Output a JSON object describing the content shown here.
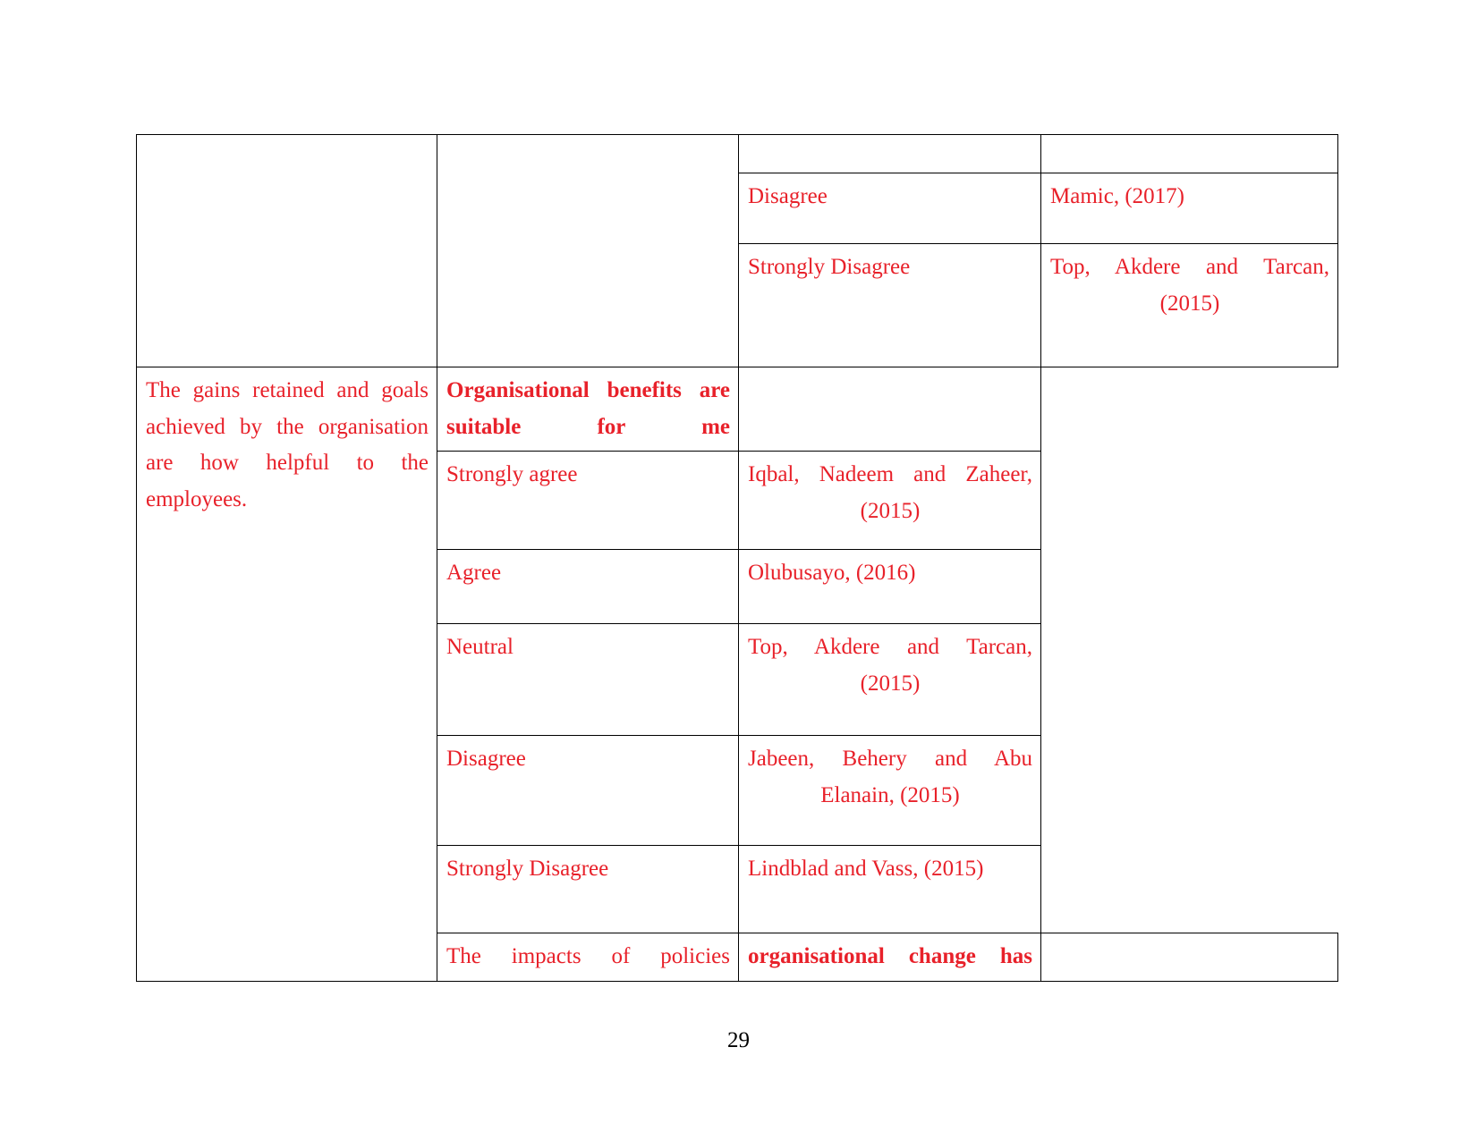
{
  "document": {
    "page_number": "29",
    "text_color": "#E8212A",
    "border_color": "#000000",
    "background": "#FFFFFF"
  },
  "table": {
    "column_count": 4,
    "rows": [
      {
        "id": "row-1",
        "col1": "",
        "col2": "",
        "col3": "",
        "col4": "",
        "col3_bold": false,
        "col1_rowspan": 11,
        "col2_rowspan": 3
      },
      {
        "id": "row-2",
        "col3": "Disagree",
        "col4": "Mamic, (2017)",
        "col3_bold": false
      },
      {
        "id": "row-3",
        "col3": "Strongly Disagree",
        "col4": "Top, Akdere and Tarcan, (2015)",
        "col3_bold": false
      },
      {
        "id": "row-4",
        "col2": "The gains retained and goals achieved by the organisation are how helpful to the employees.",
        "col2_rowspan": 7,
        "col3": "Organisational benefits are suitable for me",
        "col4": "",
        "col3_bold": true
      },
      {
        "id": "row-5",
        "col3": "Strongly agree",
        "col4": "Iqbal, Nadeem and Zaheer, (2015)",
        "col3_bold": false
      },
      {
        "id": "row-6",
        "col3": "Agree",
        "col4": "Olubusayo, (2016)",
        "col3_bold": false
      },
      {
        "id": "row-7",
        "col3": "Neutral",
        "col4": "Top, Akdere and Tarcan, (2015)",
        "col3_bold": false
      },
      {
        "id": "row-8",
        "col3": "Disagree",
        "col4": "Jabeen, Behery and Abu Elanain, (2015)",
        "col3_bold": false
      },
      {
        "id": "row-9",
        "col3": "Strongly Disagree",
        "col4": "Lindblad and Vass, (2015)",
        "col3_bold": false
      },
      {
        "id": "row-10",
        "col2": "The impacts of policies",
        "col3": "organisational change has",
        "col4": "",
        "col3_bold": true
      }
    ],
    "cells": {
      "r1c3": "",
      "r1c4": "",
      "r2c3": "Disagree",
      "r2c4": "Mamic, (2017)",
      "r3c3": "Strongly Disagree",
      "r3c4_line1": "Top, Akdere and Tarcan,",
      "r3c4_line2": "(2015)",
      "r4c2": "The gains retained and goals achieved by the organisation are how helpful to the employees.",
      "r4c3": "Organisational benefits are suitable for me",
      "r4c4": "",
      "r5c3": "Strongly agree",
      "r5c4_line1": "Iqbal, Nadeem and Zaheer,",
      "r5c4_line2": "(2015)",
      "r6c3": "Agree",
      "r6c4": "Olubusayo, (2016)",
      "r7c3": "Neutral",
      "r7c4_line1": "Top, Akdere and Tarcan,",
      "r7c4_line2": "(2015)",
      "r8c3": "Disagree",
      "r8c4_line1": "Jabeen, Behery and Abu",
      "r8c4_line2": "Elanain, (2015)",
      "r9c3": "Strongly Disagree",
      "r9c4": "Lindblad and Vass, (2015)",
      "r10c2": "The impacts of policies",
      "r10c3": "organisational change has",
      "r10c4": ""
    }
  }
}
